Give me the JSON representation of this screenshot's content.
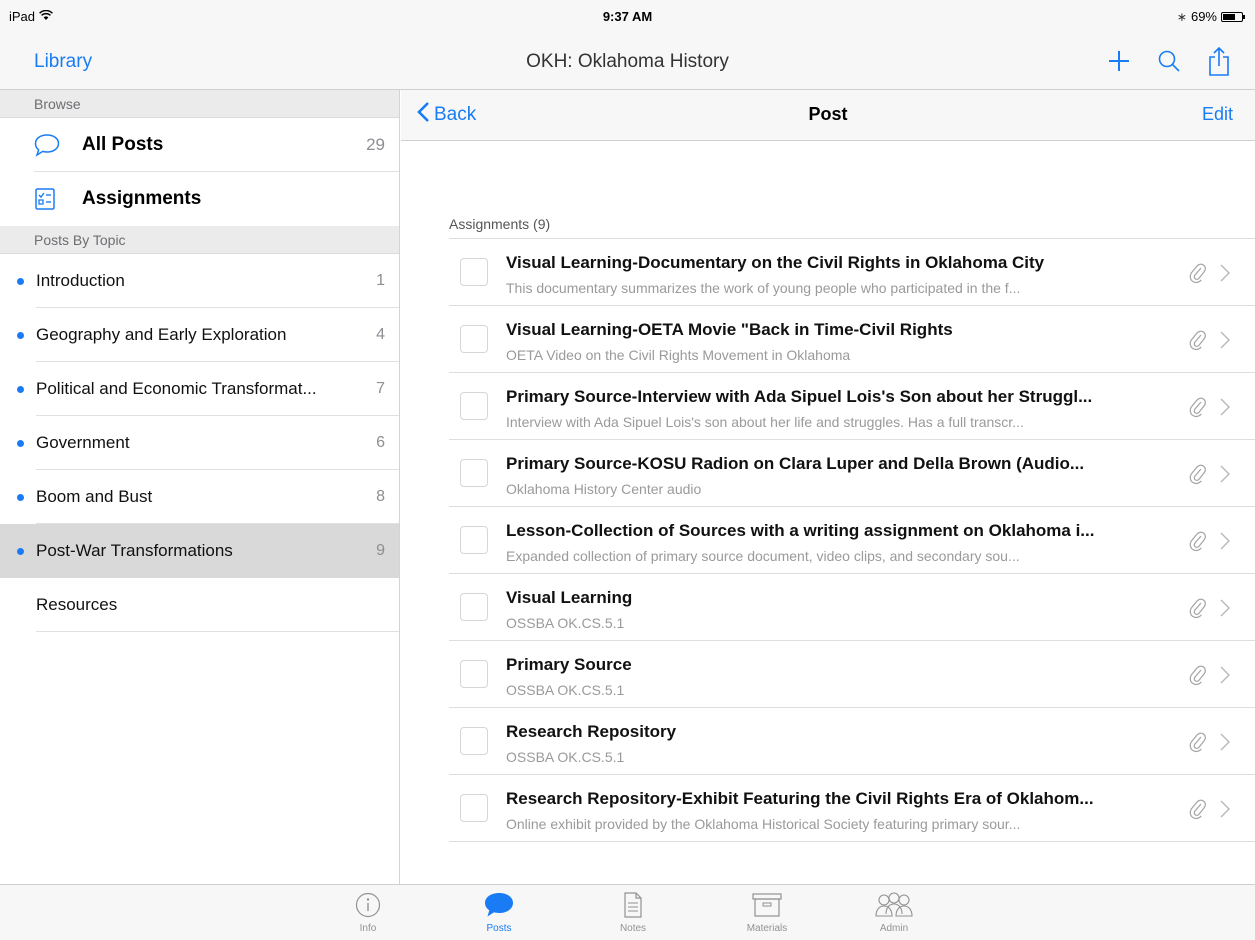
{
  "status_bar": {
    "device": "iPad",
    "time": "9:37 AM",
    "battery": "69%",
    "battery_level": 0.69
  },
  "nav": {
    "library_label": "Library",
    "title": "OKH: Oklahoma History",
    "icons": [
      "add-icon",
      "search-icon",
      "share-icon"
    ]
  },
  "sidebar": {
    "browse_header": "Browse",
    "all_posts": {
      "label": "All Posts",
      "count": "29",
      "icon": "speech-bubble-icon"
    },
    "assignments": {
      "label": "Assignments",
      "icon": "checklist-icon"
    },
    "topics_header": "Posts By Topic",
    "topics": [
      {
        "label": "Introduction",
        "count": "1"
      },
      {
        "label": "Geography and Early Exploration",
        "count": "4"
      },
      {
        "label": "Political and Economic Transformat...",
        "count": "7"
      },
      {
        "label": "Government",
        "count": "6"
      },
      {
        "label": "Boom and Bust",
        "count": "8"
      },
      {
        "label": "Post-War Transformations",
        "count": "9",
        "selected": true
      }
    ],
    "resources_label": "Resources"
  },
  "detail": {
    "back_label": "Back",
    "title": "Post",
    "edit_label": "Edit",
    "assignments_heading": "Assignments (9)",
    "assignments": [
      {
        "title": "Visual Learning-Documentary on the Civil Rights in Oklahoma City",
        "subtitle": "This documentary summarizes the work of young people who participated in the f..."
      },
      {
        "title": "Visual Learning-OETA Movie \"Back in Time-Civil Rights",
        "subtitle": "OETA Video on the Civil Rights Movement in Oklahoma"
      },
      {
        "title": "Primary Source-Interview with Ada Sipuel Lois's Son about her Struggl...",
        "subtitle": "Interview with Ada Sipuel Lois's son about her life and struggles. Has a full transcr..."
      },
      {
        "title": "Primary Source-KOSU Radion on Clara Luper and Della Brown (Audio...",
        "subtitle": "Oklahoma History Center audio"
      },
      {
        "title": "Lesson-Collection of Sources with a writing assignment on Oklahoma i...",
        "subtitle": "Expanded collection of primary source document, video clips, and secondary sou..."
      },
      {
        "title": "Visual Learning",
        "subtitle": "OSSBA OK.CS.5.1"
      },
      {
        "title": "Primary Source",
        "subtitle": "OSSBA OK.CS.5.1"
      },
      {
        "title": "Research Repository",
        "subtitle": "OSSBA OK.CS.5.1"
      },
      {
        "title": "Research Repository-Exhibit Featuring the Civil Rights Era of Oklahom...",
        "subtitle": "Online exhibit provided by the Oklahoma Historical Society featuring primary sour..."
      }
    ]
  },
  "tabs": [
    {
      "label": "Info",
      "icon": "info-icon"
    },
    {
      "label": "Posts",
      "icon": "speech-bubble-icon",
      "active": true
    },
    {
      "label": "Notes",
      "icon": "document-icon"
    },
    {
      "label": "Materials",
      "icon": "archive-box-icon"
    },
    {
      "label": "Admin",
      "icon": "people-icon"
    }
  ],
  "colors": {
    "accent": "#1a7cf5",
    "bar_background": "#f7f7f7",
    "selected_row": "#d9d9d9",
    "inactive_tab": "#929292"
  }
}
